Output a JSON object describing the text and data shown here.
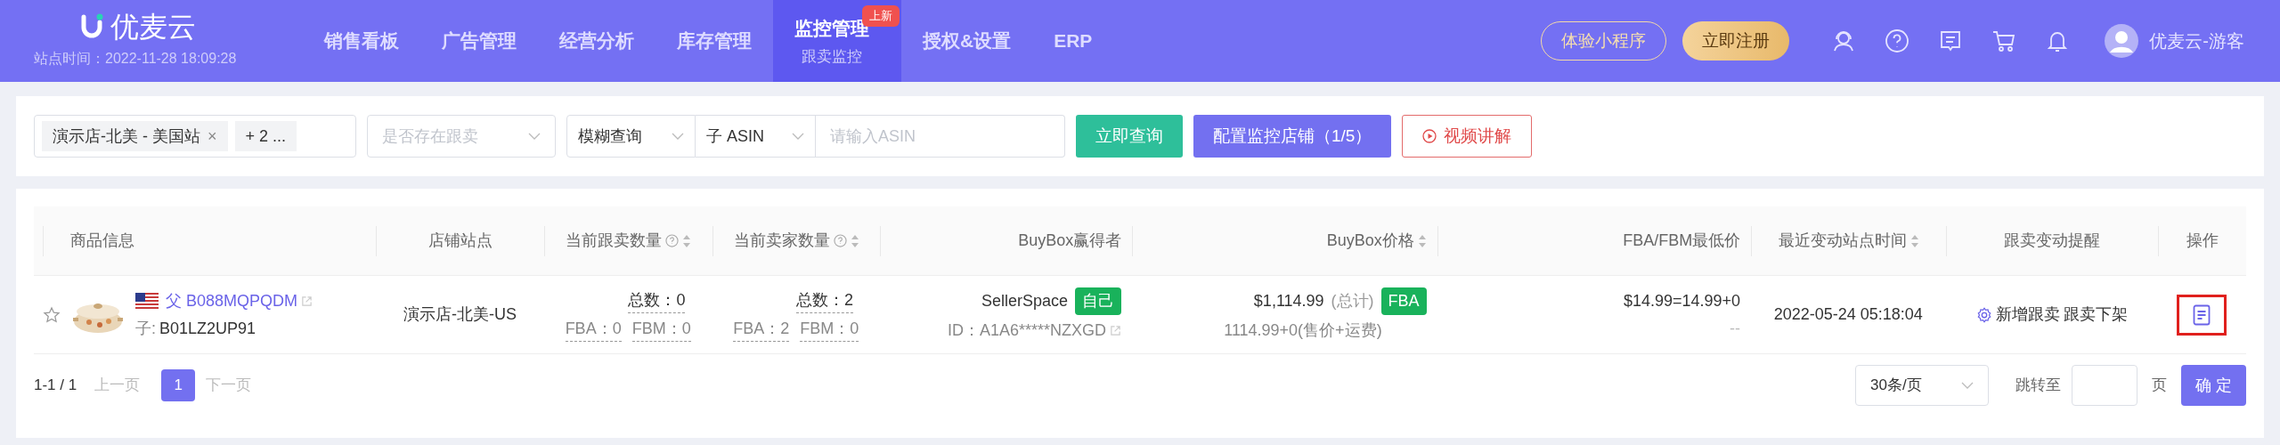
{
  "header": {
    "brand": "优麦云",
    "site_time": "站点时间：2022-11-28 18:09:28",
    "nav": [
      {
        "label": "销售看板",
        "selected": false
      },
      {
        "label": "广告管理",
        "selected": false
      },
      {
        "label": "经营分析",
        "selected": false
      },
      {
        "label": "库存管理",
        "selected": false
      },
      {
        "label": "监控管理",
        "selected": true,
        "badge": "上新",
        "sublabel": "跟卖监控"
      },
      {
        "label": "授权&设置",
        "selected": false
      },
      {
        "label": "ERP",
        "selected": false
      }
    ],
    "buttons": [
      {
        "label": "体验小程序",
        "kind": "outline"
      },
      {
        "label": "立即注册",
        "kind": "gold"
      }
    ],
    "user": "优麦云-游客"
  },
  "filters": {
    "shop_tag": "演示店-北美 - 美国站",
    "shop_close": "×",
    "shop_more": "+ 2 ...",
    "follow_select": {
      "placeholder": "是否存在跟卖"
    },
    "match_select": "模糊查询",
    "asin_type": "子 ASIN",
    "asin_input": {
      "placeholder": "请输入ASIN"
    },
    "buttons": [
      {
        "label": "立即查询",
        "kind": "green"
      },
      {
        "label": "配置监控店铺（1/5）",
        "kind": "purple"
      },
      {
        "label": "视频讲解",
        "kind": "red-outline"
      }
    ]
  },
  "table": {
    "columns": [
      {
        "label": "商品信息",
        "kind": "plain"
      },
      {
        "label": "店铺站点",
        "kind": "plain"
      },
      {
        "label": "当前跟卖数量",
        "kind": "help-sort"
      },
      {
        "label": "当前卖家数量",
        "kind": "help-sort"
      },
      {
        "label": "BuyBox赢得者",
        "kind": "plain"
      },
      {
        "label": "BuyBox价格",
        "kind": "sort"
      },
      {
        "label": "FBA/FBM最低价",
        "kind": "plain"
      },
      {
        "label": "最近变动站点时间",
        "kind": "sort"
      },
      {
        "label": "跟卖变动提醒",
        "kind": "plain"
      },
      {
        "label": "操作",
        "kind": "plain"
      }
    ],
    "rows": [
      {
        "starred": false,
        "parent_prefix": "父",
        "parent_asin": "B088MQPQDM",
        "child_prefix": "子:",
        "child_asin": "B01LZ2UP91",
        "shop": "演示店-北美-US",
        "follow": {
          "total": "总数：0",
          "fba": "FBA：0",
          "fbm": "FBM：0"
        },
        "sellers": {
          "total": "总数：2",
          "fba": "FBA：2",
          "fbm": "FBM：0"
        },
        "winner": "SellerSpace",
        "winner_tag": "自己",
        "winner_id": "ID：A1A6*****NZXGD",
        "price": "$1,114.99",
        "price_note": "(总计)",
        "price_tag": "FBA",
        "price_detail": "1114.99+0(售价+运费)",
        "lowest": "$14.99=14.99+0",
        "lowest_sub": "--",
        "time": "2022-05-24 05:18:04",
        "alerts": [
          "新增跟卖",
          "跟卖下架"
        ],
        "action_highlighted": true
      }
    ]
  },
  "pagination": {
    "range": "1-1 / 1",
    "prev": "上一页",
    "pages": [
      {
        "label": "1",
        "selected": true
      }
    ],
    "next": "下一页",
    "page_size": "30条/页",
    "jump_label": "跳转至",
    "page_unit": "页",
    "confirm": "确 定"
  }
}
